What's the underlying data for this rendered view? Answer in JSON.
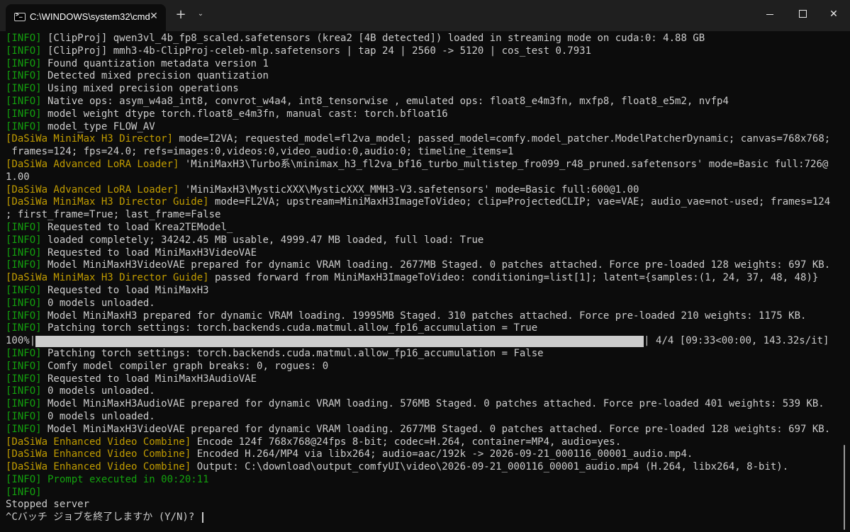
{
  "window": {
    "tab_title": "C:\\WINDOWS\\system32\\cmd",
    "newtab_label": "+",
    "close_glyph": "✕"
  },
  "colors": {
    "info": "#13a10e",
    "yellow_tag": "#c19c00",
    "text": "#cccccc",
    "background": "#0c0c0c"
  },
  "progress": {
    "value": 1.0
  },
  "console": {
    "lines": [
      {
        "tag": "[INFO]",
        "tagc": "i",
        "text": " [ClipProj] qwen3vl_4b_fp8_scaled.safetensors (krea2 [4B detected]) loaded in streaming mode on cuda:0: 4.88 GB"
      },
      {
        "tag": "[INFO]",
        "tagc": "i",
        "text": " [ClipProj] mmh3-4b-ClipProj-celeb-mlp.safetensors | tap 24 | 2560 -> 5120 | cos_test 0.7931"
      },
      {
        "tag": "[INFO]",
        "tagc": "i",
        "text": " Found quantization metadata version 1"
      },
      {
        "tag": "[INFO]",
        "tagc": "i",
        "text": " Detected mixed precision quantization"
      },
      {
        "tag": "[INFO]",
        "tagc": "i",
        "text": " Using mixed precision operations"
      },
      {
        "tag": "[INFO]",
        "tagc": "i",
        "text": " Native ops: asym_w4a8_int8, convrot_w4a4, int8_tensorwise , emulated ops: float8_e4m3fn, mxfp8, float8_e5m2, nvfp4"
      },
      {
        "tag": "[INFO]",
        "tagc": "i",
        "text": " model weight dtype torch.float8_e4m3fn, manual cast: torch.bfloat16"
      },
      {
        "tag": "[INFO]",
        "tagc": "i",
        "text": " model_type FLOW_AV"
      },
      {
        "tag": "[DaSiWa MiniMax H3 Director]",
        "tagc": "y",
        "text": " mode=I2VA; requested_model=fl2va_model; passed_model=comfy.model_patcher.ModelPatcherDynamic; canvas=768x768;"
      },
      {
        "tag": "",
        "tagc": "",
        "text": " frames=124; fps=24.0; refs=images:0,videos:0,video_audio:0,audio:0; timeline_items=1"
      },
      {
        "tag": "[DaSiWa Advanced LoRA Loader]",
        "tagc": "y",
        "text": " 'MiniMaxH3\\Turbo系\\minimax_h3_fl2va_bf16_turbo_multistep_fro099_r48_pruned.safetensors' mode=Basic full:726@"
      },
      {
        "tag": "",
        "tagc": "",
        "text": "1.00"
      },
      {
        "tag": "[DaSiWa Advanced LoRA Loader]",
        "tagc": "y",
        "text": " 'MiniMaxH3\\MysticXXX\\MysticXXX_MMH3-V3.safetensors' mode=Basic full:600@1.00"
      },
      {
        "tag": "[DaSiWa MiniMax H3 Director Guide]",
        "tagc": "y",
        "text": " mode=FL2VA; upstream=MiniMaxH3ImageToVideo; clip=ProjectedCLIP; vae=VAE; audio_vae=not-used; frames=124"
      },
      {
        "tag": "",
        "tagc": "",
        "text": "; first_frame=True; last_frame=False"
      },
      {
        "tag": "[INFO]",
        "tagc": "i",
        "text": " Requested to load Krea2TEModel_"
      },
      {
        "tag": "[INFO]",
        "tagc": "i",
        "text": " loaded completely; 34242.45 MB usable, 4999.47 MB loaded, full load: True"
      },
      {
        "tag": "[INFO]",
        "tagc": "i",
        "text": " Requested to load MiniMaxH3VideoVAE"
      },
      {
        "tag": "[INFO]",
        "tagc": "i",
        "text": " Model MiniMaxH3VideoVAE prepared for dynamic VRAM loading. 2677MB Staged. 0 patches attached. Force pre-loaded 128 weights: 697 KB."
      },
      {
        "tag": "[DaSiWa MiniMax H3 Director Guide]",
        "tagc": "y",
        "text": " passed forward from MiniMaxH3ImageToVideo: conditioning=list[1]; latent={samples:(1, 24, 37, 48, 48)}"
      },
      {
        "tag": "[INFO]",
        "tagc": "i",
        "text": " Requested to load MiniMaxH3"
      },
      {
        "tag": "[INFO]",
        "tagc": "i",
        "text": " 0 models unloaded."
      },
      {
        "tag": "[INFO]",
        "tagc": "i",
        "text": " Model MiniMaxH3 prepared for dynamic VRAM loading. 19995MB Staged. 310 patches attached. Force pre-loaded 210 weights: 1175 KB."
      },
      {
        "tag": "[INFO]",
        "tagc": "i",
        "text": " Patching torch settings: torch.backends.cuda.matmul.allow_fp16_accumulation = True"
      },
      {
        "progress": true,
        "pct": "100%|",
        "rest": "| 4/4 [09:33<00:00, 143.32s/it]"
      },
      {
        "tag": "[INFO]",
        "tagc": "i",
        "text": " Patching torch settings: torch.backends.cuda.matmul.allow_fp16_accumulation = False"
      },
      {
        "tag": "[INFO]",
        "tagc": "i",
        "text": " Comfy model compiler graph breaks: 0, rogues: 0"
      },
      {
        "tag": "[INFO]",
        "tagc": "i",
        "text": " Requested to load MiniMaxH3AudioVAE"
      },
      {
        "tag": "[INFO]",
        "tagc": "i",
        "text": " 0 models unloaded."
      },
      {
        "tag": "[INFO]",
        "tagc": "i",
        "text": " Model MiniMaxH3AudioVAE prepared for dynamic VRAM loading. 576MB Staged. 0 patches attached. Force pre-loaded 401 weights: 539 KB."
      },
      {
        "tag": "[INFO]",
        "tagc": "i",
        "text": " 0 models unloaded."
      },
      {
        "tag": "[INFO]",
        "tagc": "i",
        "text": " Model MiniMaxH3VideoVAE prepared for dynamic VRAM loading. 2677MB Staged. 0 patches attached. Force pre-loaded 128 weights: 697 KB."
      },
      {
        "tag": "[DaSiWa Enhanced Video Combine]",
        "tagc": "y",
        "text": " Encode 124f 768x768@24fps 8-bit; codec=H.264, container=MP4, audio=yes."
      },
      {
        "tag": "[DaSiWa Enhanced Video Combine]",
        "tagc": "y",
        "text": " Encoded H.264/MP4 via libx264; audio=aac/192k -> 2026-09-21_000116_00001_audio.mp4."
      },
      {
        "tag": "[DaSiWa Enhanced Video Combine]",
        "tagc": "y",
        "text": " Output: C:\\download\\output_comfyUI\\video\\2026-09-21_000116_00001_audio.mp4 (H.264, libx264, 8-bit)."
      },
      {
        "tag": "[INFO]",
        "tagc": "i",
        "text": " Prompt executed in 00:20:11",
        "textc": "g"
      },
      {
        "tag": "[INFO]",
        "tagc": "i",
        "text": ""
      },
      {
        "tag": "",
        "tagc": "",
        "text": "Stopped server"
      },
      {
        "tag": "",
        "tagc": "",
        "text": "^Cバッチ ジョブを終了しますか (Y/N)? ",
        "cursor": true
      }
    ]
  }
}
